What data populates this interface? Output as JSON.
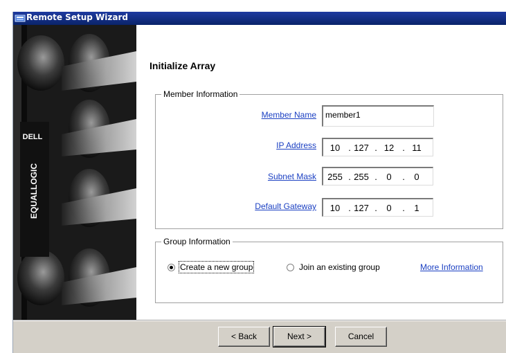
{
  "window": {
    "title": "Remote Setup Wizard"
  },
  "sidebar": {
    "brand": "DELL",
    "product": "EQUALLOGIC"
  },
  "page": {
    "heading": "Initialize Array"
  },
  "member_info": {
    "legend": "Member Information",
    "member_name_label": "Member Name",
    "member_name_value": "member1",
    "ip_label": "IP Address",
    "ip": [
      "10",
      "127",
      "12",
      "11"
    ],
    "subnet_label": "Subnet Mask",
    "subnet": [
      "255",
      "255",
      "0",
      "0"
    ],
    "gateway_label": "Default Gateway",
    "gateway": [
      "10",
      "127",
      "0",
      "1"
    ]
  },
  "group_info": {
    "legend": "Group Information",
    "options": [
      "Create a new group",
      "Join an existing group"
    ],
    "selected": "Create a new group",
    "more_link": "More Information"
  },
  "buttons": {
    "back": "< Back",
    "next": "Next >",
    "cancel": "Cancel"
  }
}
